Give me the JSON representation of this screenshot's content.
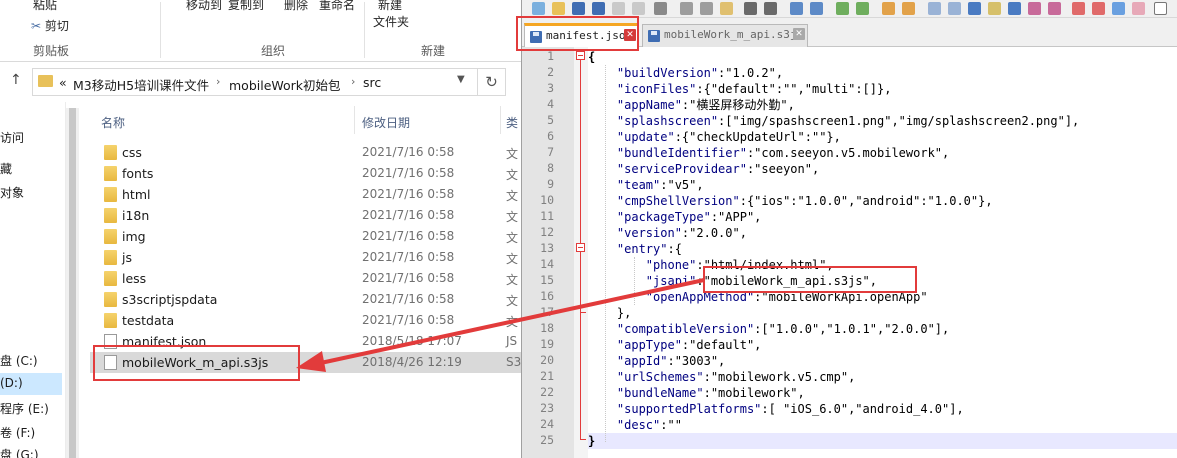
{
  "explorer": {
    "ribbon": {
      "paste": "粘贴",
      "cut": "剪切",
      "clipboard_group": "剪贴板",
      "move_to": "移动到",
      "copy_to": "复制到",
      "delete": "删除",
      "rename": "重命名",
      "organize_group": "组织",
      "new_label": "新建",
      "new_folder": "文件夹",
      "new_group": "新建"
    },
    "address": {
      "overflow": "«",
      "segments": [
        "M3移动H5培训课件文件",
        "mobileWork初始包",
        "src"
      ]
    },
    "nav_items": [
      "访问",
      "藏",
      "对象",
      "盘 (C:)",
      "(D:)",
      "程序 (E:)",
      "卷 (F:)",
      "盘 (G:)"
    ],
    "columns": {
      "name": "名称",
      "date": "修改日期",
      "type": "类"
    },
    "files": [
      {
        "name": "css",
        "date": "2021/7/16 0:58",
        "type": "文",
        "kind": "folder"
      },
      {
        "name": "fonts",
        "date": "2021/7/16 0:58",
        "type": "文",
        "kind": "folder"
      },
      {
        "name": "html",
        "date": "2021/7/16 0:58",
        "type": "文",
        "kind": "folder"
      },
      {
        "name": "i18n",
        "date": "2021/7/16 0:58",
        "type": "文",
        "kind": "folder"
      },
      {
        "name": "img",
        "date": "2021/7/16 0:58",
        "type": "文",
        "kind": "folder"
      },
      {
        "name": "js",
        "date": "2021/7/16 0:58",
        "type": "文",
        "kind": "folder"
      },
      {
        "name": "less",
        "date": "2021/7/16 0:58",
        "type": "文",
        "kind": "folder"
      },
      {
        "name": "s3scriptjspdata",
        "date": "2021/7/16 0:58",
        "type": "文",
        "kind": "folder"
      },
      {
        "name": "testdata",
        "date": "2021/7/16 0:58",
        "type": "文",
        "kind": "folder"
      },
      {
        "name": "manifest.json",
        "date": "2018/5/18 17:07",
        "type": "JS",
        "kind": "file"
      },
      {
        "name": "mobileWork_m_api.s3js",
        "date": "2018/4/26 12:19",
        "type": "S3",
        "kind": "file"
      }
    ]
  },
  "editor": {
    "tabs": [
      {
        "title": "manifest.json",
        "active": true
      },
      {
        "title": "mobileWork_m_api.s3js",
        "active": false
      }
    ],
    "lines": [
      [
        [
          "p",
          "{"
        ]
      ],
      [
        [
          "k",
          "    \"buildVersion\""
        ],
        [
          "v",
          ":\"1.0.2\","
        ]
      ],
      [
        [
          "k",
          "    \"iconFiles\""
        ],
        [
          "v",
          ":{\"default\":\"\",\"multi\":[]},"
        ]
      ],
      [
        [
          "k",
          "    \"appName\""
        ],
        [
          "v",
          ":\"横竖屏移动外勤\","
        ]
      ],
      [
        [
          "k",
          "    \"splashscreen\""
        ],
        [
          "v",
          ":[\"img/spashscreen1.png\",\"img/splashscreen2.png\"],"
        ]
      ],
      [
        [
          "k",
          "    \"update\""
        ],
        [
          "v",
          ":{\"checkUpdateUrl\":\"\"},"
        ]
      ],
      [
        [
          "k",
          "    \"bundleIdentifier\""
        ],
        [
          "v",
          ":\"com.seeyon.v5.mobilework\","
        ]
      ],
      [
        [
          "k",
          "    \"serviceProvidear\""
        ],
        [
          "v",
          ":\"seeyon\","
        ]
      ],
      [
        [
          "k",
          "    \"team\""
        ],
        [
          "v",
          ":\"v5\","
        ]
      ],
      [
        [
          "k",
          "    \"cmpShellVersion\""
        ],
        [
          "v",
          ":{\"ios\":\"1.0.0\",\"android\":\"1.0.0\"},"
        ]
      ],
      [
        [
          "k",
          "    \"packageType\""
        ],
        [
          "v",
          ":\"APP\","
        ]
      ],
      [
        [
          "k",
          "    \"version\""
        ],
        [
          "v",
          ":\"2.0.0\","
        ]
      ],
      [
        [
          "k",
          "    \"entry\""
        ],
        [
          "v",
          ":{"
        ]
      ],
      [
        [
          "k",
          "        \"phone\""
        ],
        [
          "v",
          ":\"html/index.html\","
        ]
      ],
      [
        [
          "k",
          "        \"jsapi\""
        ],
        [
          "v",
          ":\"mobileWork_m_api.s3js\","
        ]
      ],
      [
        [
          "k",
          "        \"openAppMethod\""
        ],
        [
          "v",
          ":\"mobileWorkApi.openApp\""
        ]
      ],
      [
        [
          "v",
          "    },"
        ]
      ],
      [
        [
          "k",
          "    \"compatibleVersion\""
        ],
        [
          "v",
          ":[\"1.0.0\",\"1.0.1\",\"2.0.0\"],"
        ]
      ],
      [
        [
          "k",
          "    \"appType\""
        ],
        [
          "v",
          ":\"default\","
        ]
      ],
      [
        [
          "k",
          "    \"appId\""
        ],
        [
          "v",
          ":\"3003\","
        ]
      ],
      [
        [
          "k",
          "    \"urlSchemes\""
        ],
        [
          "v",
          ":\"mobilework.v5.cmp\","
        ]
      ],
      [
        [
          "k",
          "    \"bundleName\""
        ],
        [
          "v",
          ":\"mobilework\","
        ]
      ],
      [
        [
          "k",
          "    \"supportedPlatforms\""
        ],
        [
          "v",
          ":[ \"iOS_6.0\",\"android_4.0\"],"
        ]
      ],
      [
        [
          "k",
          "    \"desc\""
        ],
        [
          "v",
          ":\"\""
        ]
      ],
      [
        [
          "p",
          "}"
        ]
      ]
    ],
    "line_numbers": [
      "1",
      "2",
      "3",
      "4",
      "5",
      "6",
      "7",
      "8",
      "9",
      "10",
      "11",
      "12",
      "13",
      "14",
      "15",
      "16",
      "17",
      "18",
      "19",
      "20",
      "21",
      "22",
      "23",
      "24",
      "25"
    ]
  },
  "colors": {
    "annotation": "#e23b3b",
    "json_key": "#000080",
    "tab_active_accent": "#f5a623",
    "selection": "#d9d9d9"
  }
}
